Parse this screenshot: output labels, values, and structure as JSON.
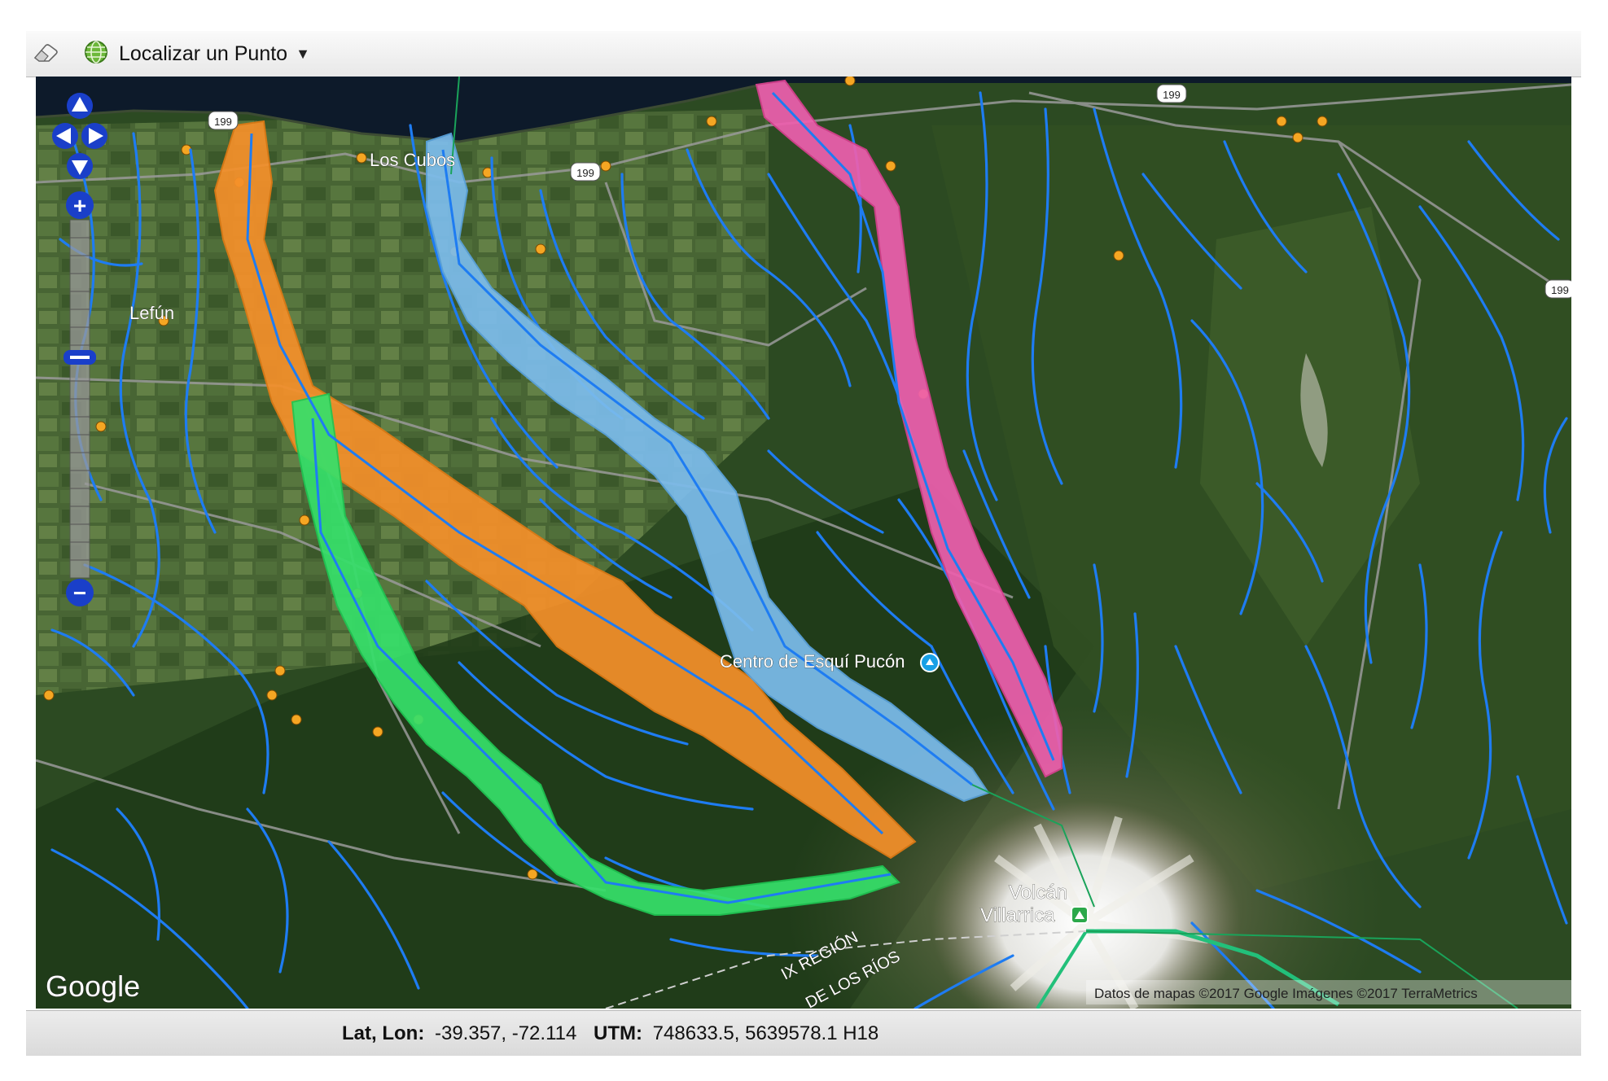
{
  "toolbar": {
    "eraser_icon": "eraser-icon",
    "locate_icon": "globe-icon",
    "locate_label": "Localizar un Punto",
    "caret_icon": "caret-down-icon"
  },
  "map": {
    "labels": {
      "los_cubos": "Los Cubos",
      "lefun": "Lefún",
      "centro_esqui": "Centro de Esquí Pucón",
      "volcan": "Volcán",
      "volcan2": "Villarrica",
      "region": "IX REGIÓN",
      "los_rios": "DE LOS RÍOS"
    },
    "route_shields": [
      "199",
      "199",
      "199",
      "199"
    ],
    "google_logo": "Google",
    "attribution": "Datos de mapas ©2017 Google Imágenes ©2017 TerraMetrics",
    "colors": {
      "rivers": "#1e7cf2",
      "orange_zone": "#f5902a",
      "lightblue_zone": "#7cbcec",
      "pink_zone": "#ee5fae",
      "green_zone": "#36e06a",
      "roads": "#9a9a9a",
      "towns": "#f5a623",
      "boundary": "#1aa35a"
    }
  },
  "navigation": {
    "pan_up": "arrow-up-icon",
    "pan_left": "arrow-left-icon",
    "pan_right": "arrow-right-icon",
    "pan_down": "arrow-down-icon",
    "zoom_in": "+",
    "zoom_out": "−"
  },
  "status": {
    "latlon_label": "Lat, Lon:",
    "latlon_value": "-39.357, -72.114",
    "utm_label": "UTM:",
    "utm_value": "748633.5, 5639578.1 H18"
  }
}
